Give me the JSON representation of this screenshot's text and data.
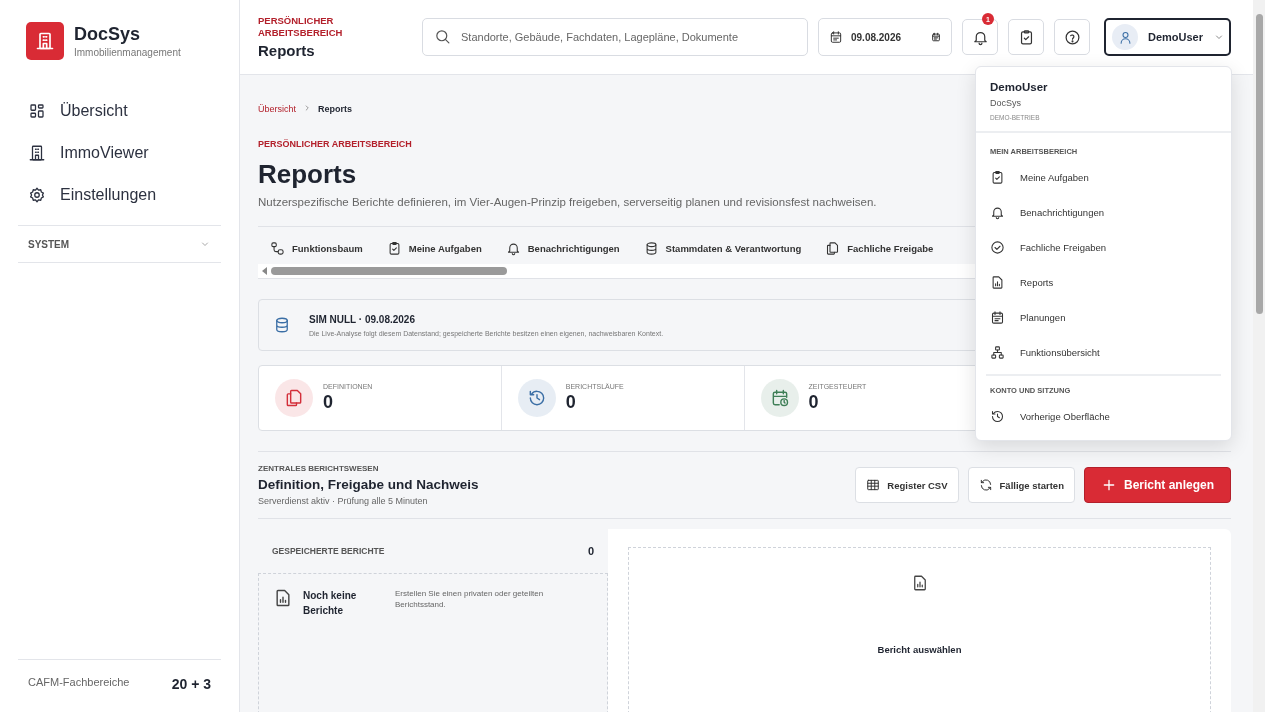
{
  "sidebar": {
    "app_name": "DocSys",
    "app_subtitle": "Immobilienmanagement",
    "items": [
      {
        "label": "Übersicht"
      },
      {
        "label": "ImmoViewer"
      },
      {
        "label": "Einstellungen"
      }
    ],
    "section": {
      "label": "SYSTEM",
      "expanded": false
    },
    "footer": {
      "label": "CAFM-Fachbereiche",
      "value": "20 + 3"
    }
  },
  "header": {
    "eyebrow": "PERSÖNLICHER ARBEITSBEREICH",
    "title": "Reports",
    "search_placeholder": "Standorte, Gebäude, Fachdaten, Lagepläne, Dokumente",
    "date": "09.08.2026",
    "notification_badge": "1",
    "user": "DemoUser"
  },
  "user_menu": {
    "expanded": true,
    "name": "DemoUser",
    "org": "DocSys",
    "tenant": "DEMO-BETRIEB",
    "sections": [
      {
        "title": "MEIN ARBEITSBEREICH",
        "items": [
          "Meine Aufgaben",
          "Benachrichtigungen",
          "Fachliche Freigaben",
          "Reports",
          "Planungen",
          "Funktionsübersicht"
        ]
      },
      {
        "title": "KONTO UND SITZUNG",
        "items": [
          "Vorherige Oberfläche"
        ]
      }
    ]
  },
  "breadcrumb": [
    "Übersicht",
    "Reports"
  ],
  "page": {
    "eyebrow": "PERSÖNLICHER ARBEITSBEREICH",
    "title": "Reports",
    "description": "Nutzerspezifische Berichte definieren, im Vier-Augen-Prinzip freigeben, serverseitig planen und revisionsfest nachweisen."
  },
  "tabs": [
    {
      "label": "Funktionsbaum"
    },
    {
      "label": "Meine Aufgaben"
    },
    {
      "label": "Benachrichtigungen"
    },
    {
      "label": "Stammdaten & Verantwortung"
    },
    {
      "label": "Fachliche Freigabe"
    }
  ],
  "context": {
    "title": "SIM NULL · 09.08.2026",
    "text": "Die Live-Analyse folgt diesem Datenstand; gespeicherte Berichte besitzen einen eigenen, nachweisbaren Kontext."
  },
  "stats": [
    {
      "label": "DEFINITIONEN",
      "value": "0",
      "color": "#d32f3a"
    },
    {
      "label": "BERICHTSLÄUFE",
      "value": "0",
      "color": "#3a6ea5"
    },
    {
      "label": "ZEITGESTEUERT",
      "value": "0",
      "color": "#3f7f57"
    }
  ],
  "section": {
    "eyebrow": "ZENTRALES BERICHTSWESEN",
    "title": "Definition, Freigabe und Nachweis",
    "subtitle": "Serverdienst aktiv · Prüfung alle 5 Minuten",
    "buttons": [
      {
        "label": "Register CSV",
        "kind": "secondary"
      },
      {
        "label": "Fällige starten",
        "kind": "secondary"
      },
      {
        "label": "Bericht anlegen",
        "kind": "primary"
      }
    ]
  },
  "saved": {
    "title": "GESPEICHERTE BERICHTE",
    "count": "0",
    "empty_title": "Noch keine Berichte",
    "empty_text": "Erstellen Sie einen privaten oder geteilten Berichtsstand."
  },
  "detail": {
    "placeholder": "Bericht auswählen"
  }
}
